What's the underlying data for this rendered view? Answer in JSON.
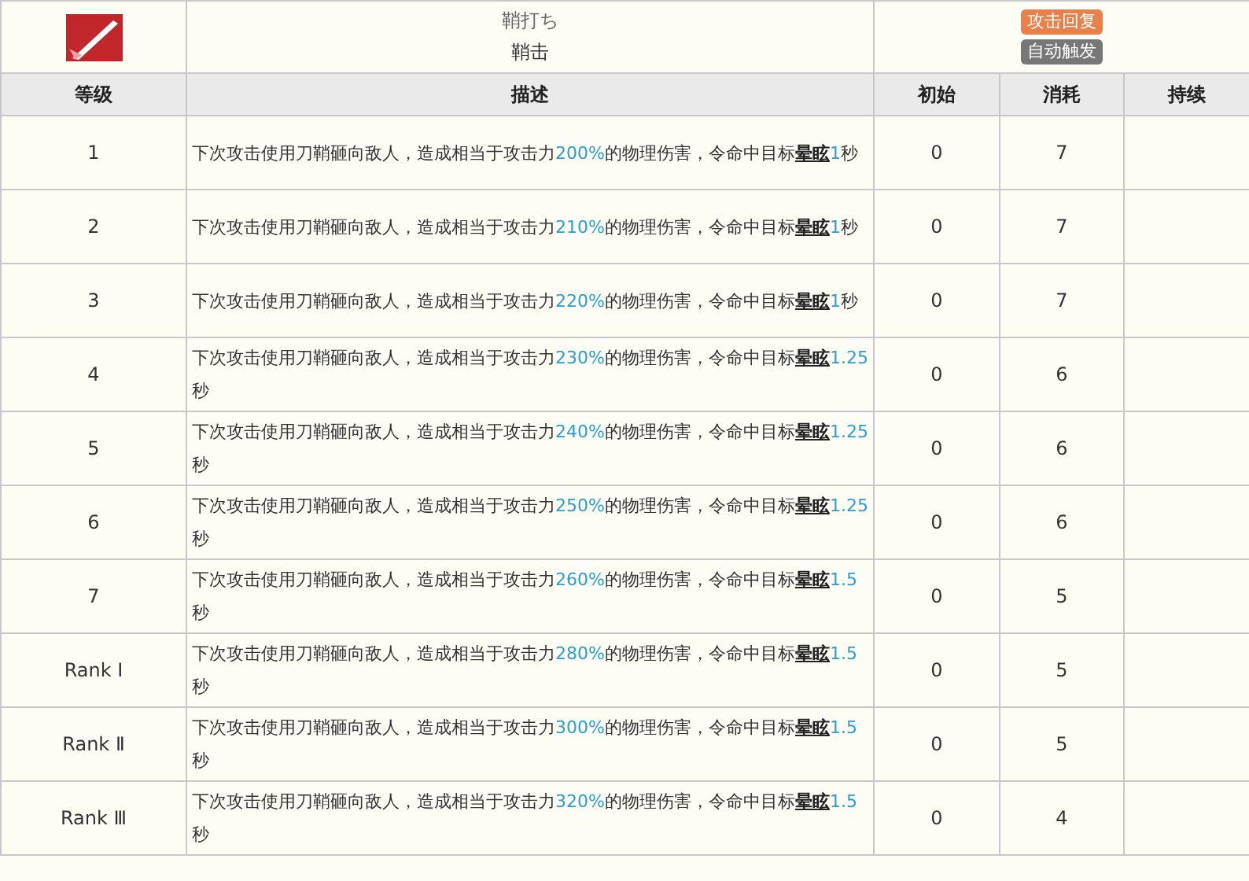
{
  "skill": {
    "name_jp": "鞘打ち",
    "name": "鞘击",
    "tags": [
      {
        "label": "攻击回复",
        "color": "#e8804a"
      },
      {
        "label": "自动触发",
        "color": "#777777"
      }
    ]
  },
  "table": {
    "columns": [
      "等级",
      "描述",
      "初始",
      "消耗",
      "持续"
    ],
    "rows": [
      {
        "level": "1",
        "description": [
          {
            "kind": "plain",
            "text": "下次攻击使用刀鞘砸向敌人，造成相当于攻击力"
          },
          {
            "kind": "value",
            "text": "200%"
          },
          {
            "kind": "plain",
            "text": "的物理伤害，令命中目标"
          },
          {
            "kind": "term",
            "text": "晕眩"
          },
          {
            "kind": "value",
            "text": "1"
          },
          {
            "kind": "plain",
            "text": "秒"
          }
        ],
        "initial": "0",
        "cost": "7"
      },
      {
        "level": "2",
        "description": [
          {
            "kind": "plain",
            "text": "下次攻击使用刀鞘砸向敌人，造成相当于攻击力"
          },
          {
            "kind": "value",
            "text": "210%"
          },
          {
            "kind": "plain",
            "text": "的物理伤害，令命中目标"
          },
          {
            "kind": "term",
            "text": "晕眩"
          },
          {
            "kind": "value",
            "text": "1"
          },
          {
            "kind": "plain",
            "text": "秒"
          }
        ],
        "initial": "0",
        "cost": "7"
      },
      {
        "level": "3",
        "description": [
          {
            "kind": "plain",
            "text": "下次攻击使用刀鞘砸向敌人，造成相当于攻击力"
          },
          {
            "kind": "value",
            "text": "220%"
          },
          {
            "kind": "plain",
            "text": "的物理伤害，令命中目标"
          },
          {
            "kind": "term",
            "text": "晕眩"
          },
          {
            "kind": "value",
            "text": "1"
          },
          {
            "kind": "plain",
            "text": "秒"
          }
        ],
        "initial": "0",
        "cost": "7"
      },
      {
        "level": "4",
        "description": [
          {
            "kind": "plain",
            "text": "下次攻击使用刀鞘砸向敌人，造成相当于攻击力"
          },
          {
            "kind": "value",
            "text": "230%"
          },
          {
            "kind": "plain",
            "text": "的物理伤害，令命中目标"
          },
          {
            "kind": "term",
            "text": "晕眩"
          },
          {
            "kind": "value",
            "text": "1.25"
          },
          {
            "kind": "plain",
            "text": "秒"
          }
        ],
        "initial": "0",
        "cost": "6"
      },
      {
        "level": "5",
        "description": [
          {
            "kind": "plain",
            "text": "下次攻击使用刀鞘砸向敌人，造成相当于攻击力"
          },
          {
            "kind": "value",
            "text": "240%"
          },
          {
            "kind": "plain",
            "text": "的物理伤害，令命中目标"
          },
          {
            "kind": "term",
            "text": "晕眩"
          },
          {
            "kind": "value",
            "text": "1.25"
          },
          {
            "kind": "plain",
            "text": "秒"
          }
        ],
        "initial": "0",
        "cost": "6"
      },
      {
        "level": "6",
        "description": [
          {
            "kind": "plain",
            "text": "下次攻击使用刀鞘砸向敌人，造成相当于攻击力"
          },
          {
            "kind": "value",
            "text": "250%"
          },
          {
            "kind": "plain",
            "text": "的物理伤害，令命中目标"
          },
          {
            "kind": "term",
            "text": "晕眩"
          },
          {
            "kind": "value",
            "text": "1.25"
          },
          {
            "kind": "plain",
            "text": "秒"
          }
        ],
        "initial": "0",
        "cost": "6"
      },
      {
        "level": "7",
        "description": [
          {
            "kind": "plain",
            "text": "下次攻击使用刀鞘砸向敌人，造成相当于攻击力"
          },
          {
            "kind": "value",
            "text": "260%"
          },
          {
            "kind": "plain",
            "text": "的物理伤害，令命中目标"
          },
          {
            "kind": "term",
            "text": "晕眩"
          },
          {
            "kind": "value",
            "text": "1.5"
          },
          {
            "kind": "plain",
            "text": "秒"
          }
        ],
        "initial": "0",
        "cost": "5"
      },
      {
        "level": "Rank Ⅰ",
        "description": [
          {
            "kind": "plain",
            "text": "下次攻击使用刀鞘砸向敌人，造成相当于攻击力"
          },
          {
            "kind": "value",
            "text": "280%"
          },
          {
            "kind": "plain",
            "text": "的物理伤害，令命中目标"
          },
          {
            "kind": "term",
            "text": "晕眩"
          },
          {
            "kind": "value",
            "text": "1.5"
          },
          {
            "kind": "plain",
            "text": "秒"
          }
        ],
        "initial": "0",
        "cost": "5"
      },
      {
        "level": "Rank Ⅱ",
        "description": [
          {
            "kind": "plain",
            "text": "下次攻击使用刀鞘砸向敌人，造成相当于攻击力"
          },
          {
            "kind": "value",
            "text": "300%"
          },
          {
            "kind": "plain",
            "text": "的物理伤害，令命中目标"
          },
          {
            "kind": "term",
            "text": "晕眩"
          },
          {
            "kind": "value",
            "text": "1.5"
          },
          {
            "kind": "plain",
            "text": "秒"
          }
        ],
        "initial": "0",
        "cost": "5"
      },
      {
        "level": "Rank Ⅲ",
        "description": [
          {
            "kind": "plain",
            "text": "下次攻击使用刀鞘砸向敌人，造成相当于攻击力"
          },
          {
            "kind": "value",
            "text": "320%"
          },
          {
            "kind": "plain",
            "text": "的物理伤害，令命中目标"
          },
          {
            "kind": "term",
            "text": "晕眩"
          },
          {
            "kind": "value",
            "text": "1.5"
          },
          {
            "kind": "plain",
            "text": "秒"
          }
        ],
        "initial": "0",
        "cost": "4"
      }
    ]
  }
}
